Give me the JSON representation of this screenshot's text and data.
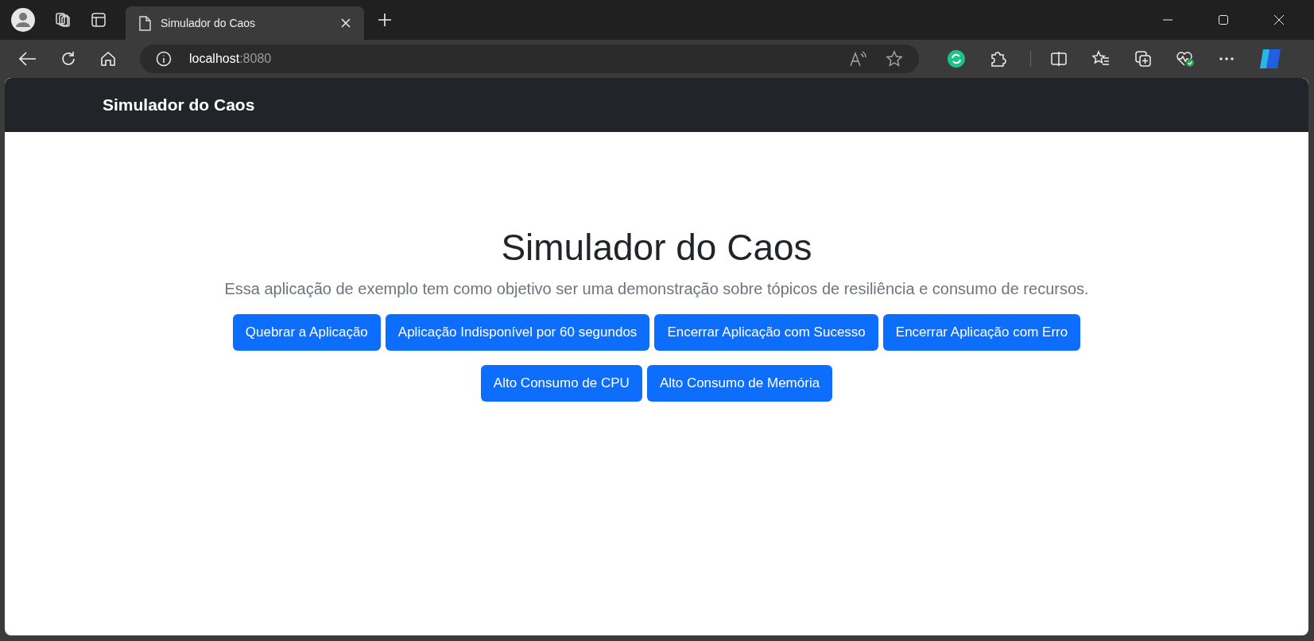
{
  "browser": {
    "tabs": [
      {
        "title": "Simulador do Caos",
        "selected": true
      }
    ],
    "address": {
      "host": "localhost",
      "port": ":8080"
    }
  },
  "navbar": {
    "brand": "Simulador do Caos"
  },
  "hero": {
    "title": "Simulador do Caos",
    "lead": "Essa aplicação de exemplo tem como objetivo ser uma demonstração sobre tópicos de resiliência e consumo de recursos.",
    "button_rows": [
      [
        "Quebrar a Aplicação",
        "Aplicação Indisponível por 60 segundos",
        "Encerrar Aplicação com Sucesso",
        "Encerrar Aplicação com Erro"
      ],
      [
        "Alto Consumo de CPU",
        "Alto Consumo de Memória"
      ]
    ]
  }
}
